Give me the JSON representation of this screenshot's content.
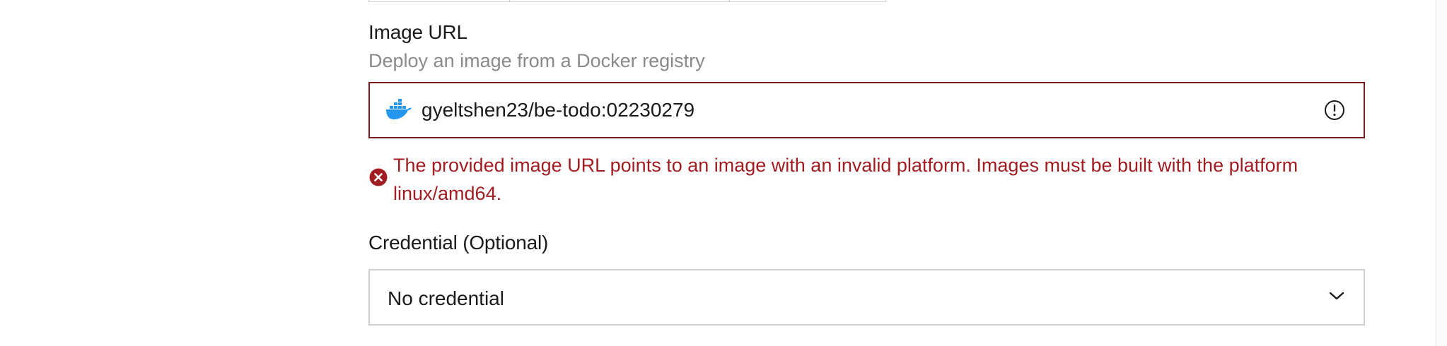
{
  "image_url_field": {
    "label": "Image URL",
    "help_text": "Deploy an image from a Docker registry",
    "value": "gyeltshen23/be-todo:02230279",
    "leading_icon": "docker-icon",
    "trailing_icon": "alert-circle-icon",
    "error_border_color": "#7a1a1f"
  },
  "error_message": {
    "icon": "error-x-circle-icon",
    "text": "The provided image URL points to an image with an invalid platform. Images must be built with the platform linux/amd64.",
    "color": "#a11d21"
  },
  "credential_field": {
    "label": "Credential (Optional)",
    "selected": "No credential",
    "trailing_icon": "chevron-down-icon"
  },
  "colors": {
    "docker_blue": "#2496ed",
    "help_text_gray": "#8a8a8a"
  }
}
